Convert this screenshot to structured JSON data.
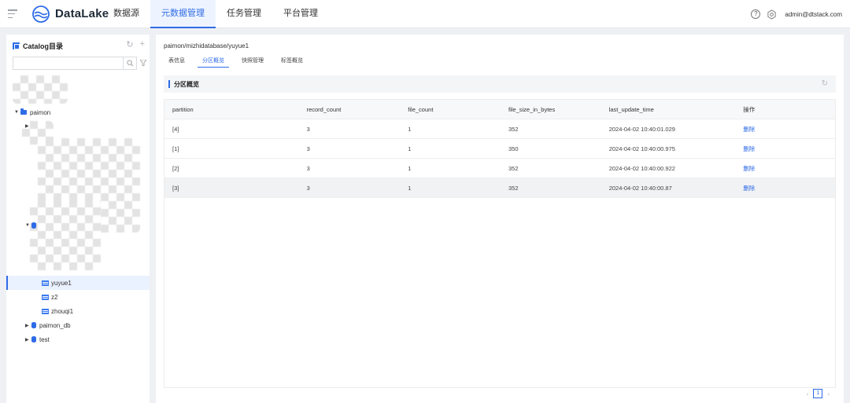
{
  "header": {
    "brand": "DataLake",
    "nav": [
      {
        "label": "数据源"
      },
      {
        "label": "元数据管理",
        "active": true
      },
      {
        "label": "任务管理"
      },
      {
        "label": "平台管理"
      }
    ],
    "help_glyph": "?",
    "user_email": "admin@dtstack.com"
  },
  "sidebar": {
    "title": "Catalog目录",
    "refresh_glyph": "↻",
    "add_glyph": "+",
    "search": {
      "value": "",
      "placeholder": ""
    },
    "tree": {
      "catalog_paimon": "paimon",
      "table_yuyue1": "yuyue1",
      "table_z2": "z2",
      "table_zhouqi1": "zhouqi1",
      "db_paimon_db": "paimon_db",
      "db_test": "test"
    }
  },
  "main": {
    "breadcrumb": "paimon/mizhidatabase/yuyue1",
    "tabs": [
      {
        "label": "表信息"
      },
      {
        "label": "分区概览",
        "active": true
      },
      {
        "label": "快照管理"
      },
      {
        "label": "标签概览"
      }
    ],
    "section_title": "分区概览",
    "table": {
      "columns": [
        "partition",
        "record_count",
        "file_count",
        "file_size_in_bytes",
        "last_update_time",
        "操作"
      ],
      "rows": [
        {
          "partition": "[4]",
          "record_count": "3",
          "file_count": "1",
          "file_size_in_bytes": "352",
          "last_update_time": "2024-04-02 10:40:01.029",
          "action": "删除"
        },
        {
          "partition": "[1]",
          "record_count": "3",
          "file_count": "1",
          "file_size_in_bytes": "350",
          "last_update_time": "2024-04-02 10:40:00.975",
          "action": "删除"
        },
        {
          "partition": "[2]",
          "record_count": "3",
          "file_count": "1",
          "file_size_in_bytes": "352",
          "last_update_time": "2024-04-02 10:40:00.922",
          "action": "删除"
        },
        {
          "partition": "[3]",
          "record_count": "3",
          "file_count": "1",
          "file_size_in_bytes": "352",
          "last_update_time": "2024-04-02 10:40:00.87",
          "action": "删除"
        }
      ]
    },
    "pager": {
      "prev": "‹",
      "current": "1",
      "next": "›"
    }
  },
  "colors": {
    "accent": "#2e6be6",
    "selected_bg": "#eaf1ff"
  }
}
